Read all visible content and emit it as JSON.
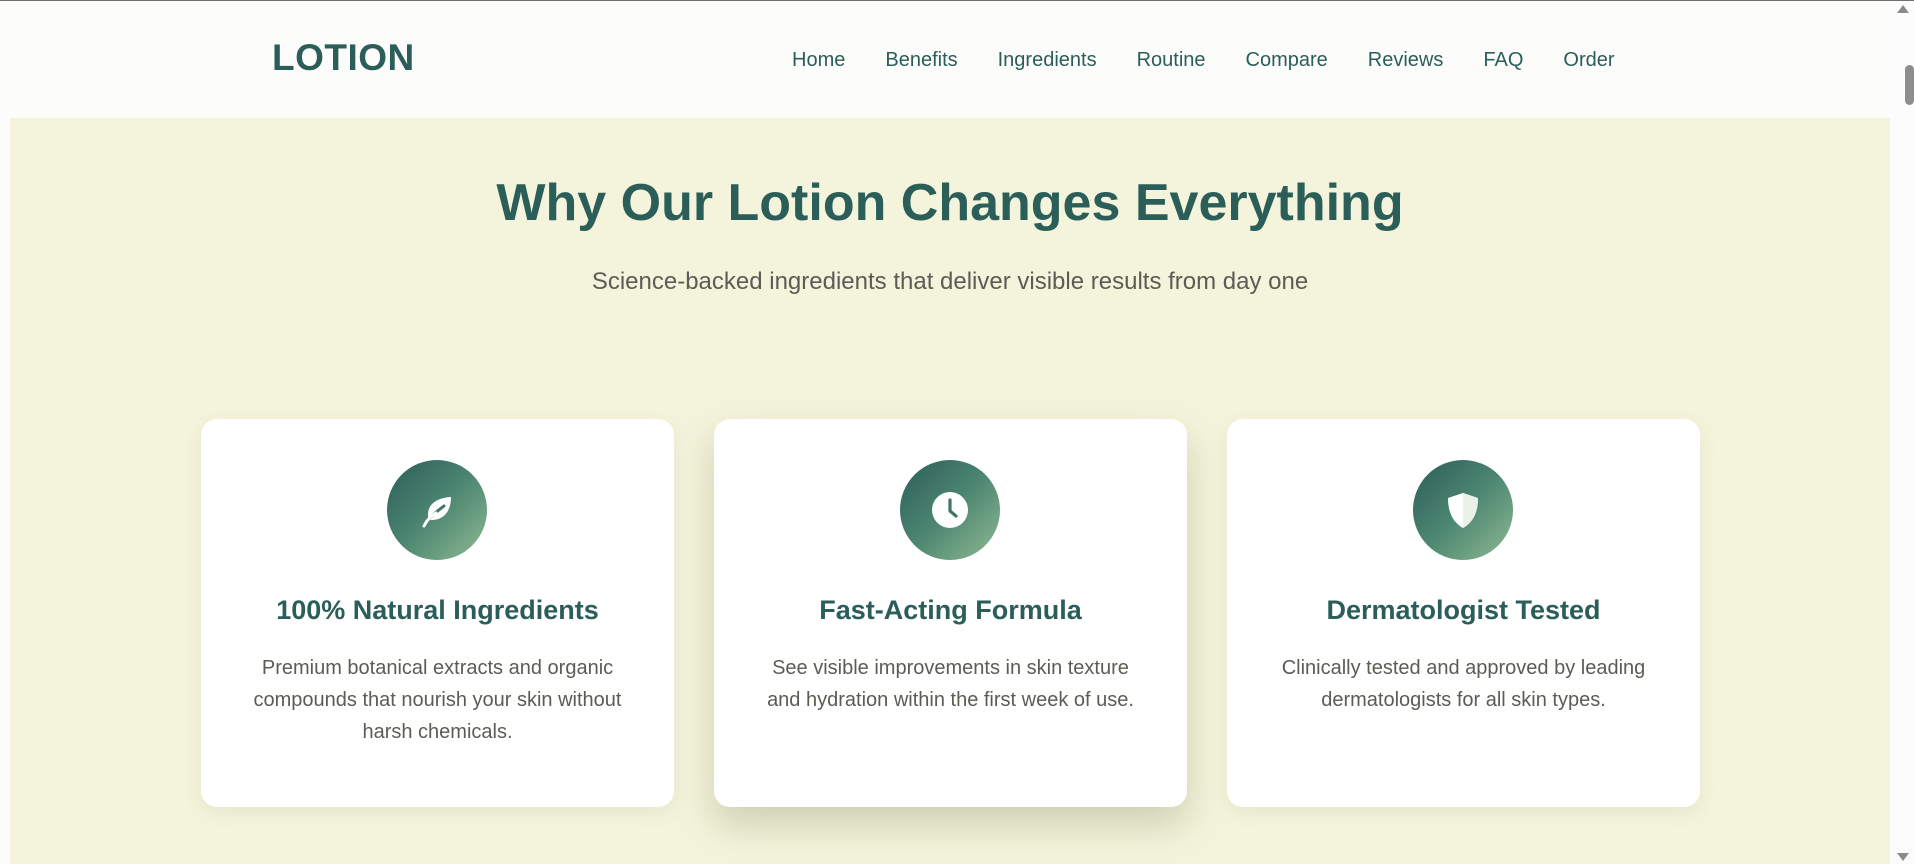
{
  "brand": {
    "logo": "LOTION"
  },
  "nav": {
    "items": [
      "Home",
      "Benefits",
      "Ingredients",
      "Routine",
      "Compare",
      "Reviews",
      "FAQ",
      "Order"
    ]
  },
  "section": {
    "title": "Why Our Lotion Changes Everything",
    "subtitle": "Science-backed ingredients that deliver visible results from day one"
  },
  "cards": [
    {
      "icon": "leaf-icon",
      "title": "100% Natural Ingredients",
      "description": "Premium botanical extracts and organic compounds that nourish your skin without harsh chemicals."
    },
    {
      "icon": "clock-icon",
      "title": "Fast-Acting Formula",
      "description": "See visible improvements in skin texture and hydration within the first week of use."
    },
    {
      "icon": "shield-icon",
      "title": "Dermatologist Tested",
      "description": "Clinically tested and approved by leading dermatologists for all skin types."
    }
  ],
  "colors": {
    "primary": "#2b5e58",
    "section_bg": "#f4f4dc",
    "card_bg": "#ffffff",
    "body_text": "#5c5c55",
    "icon_gradient_end": "#8fbb92"
  }
}
